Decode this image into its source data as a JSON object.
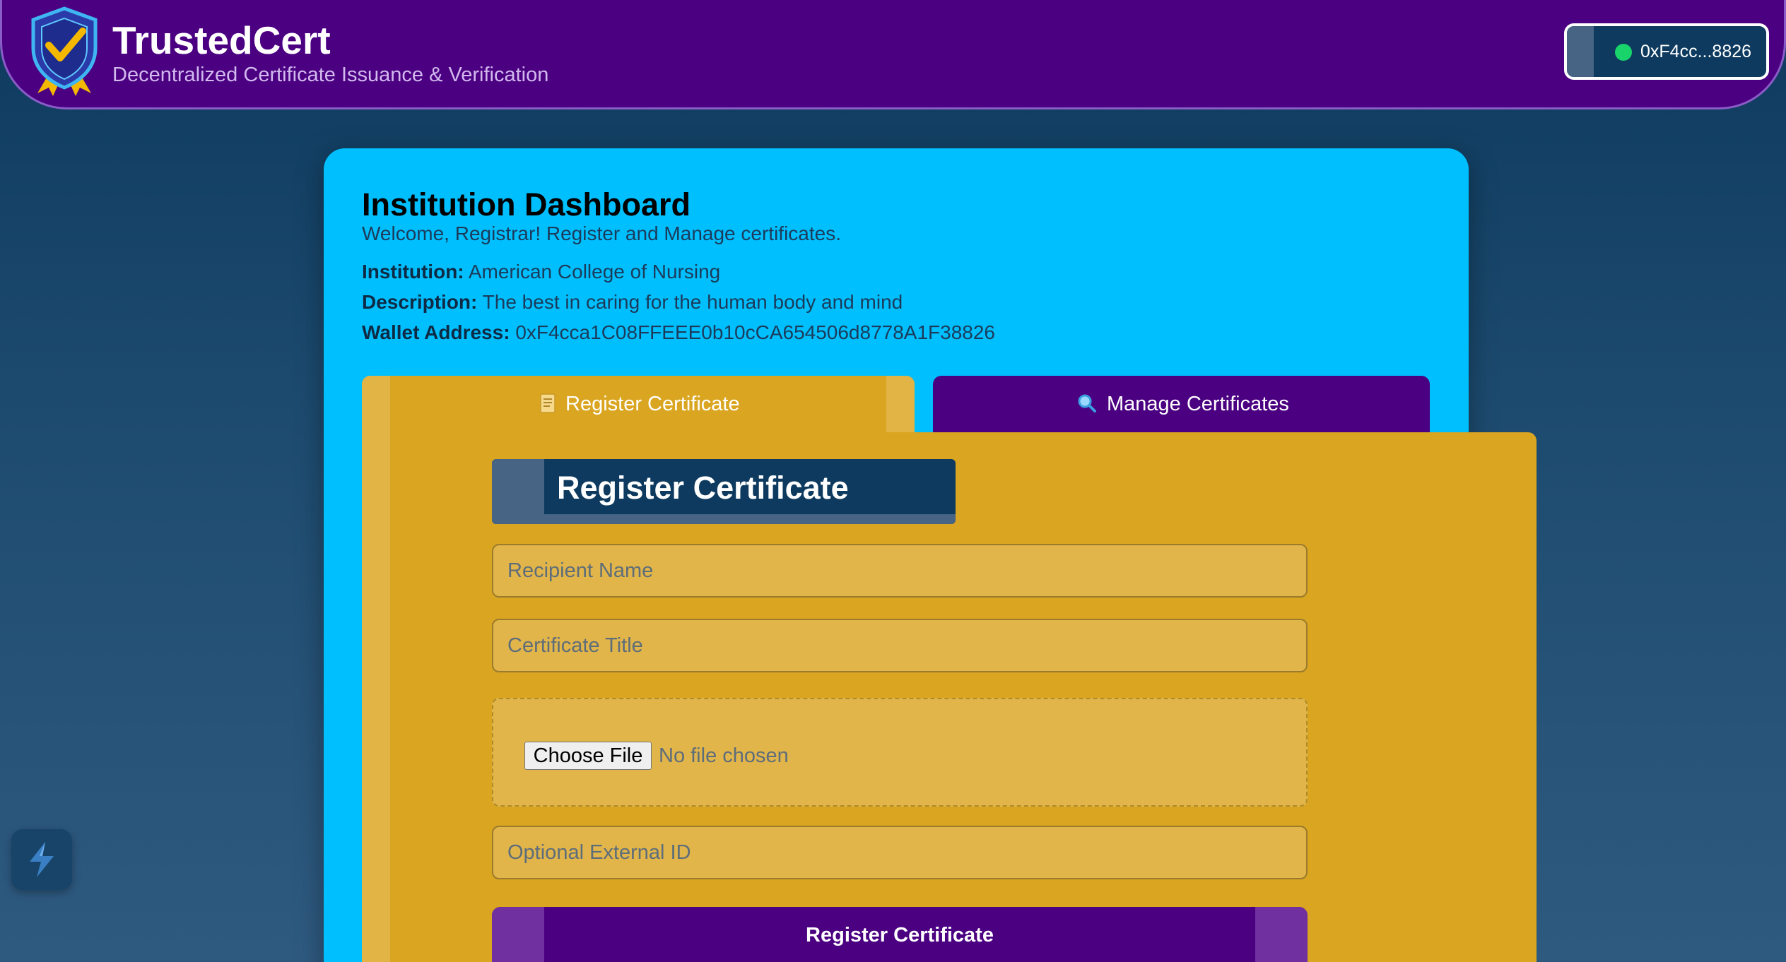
{
  "header": {
    "title": "TrustedCert",
    "subtitle": "Decentralized Certificate Issuance & Verification",
    "logo_icon": "shield-check-icon",
    "wallet": {
      "address_short": "0xF4cc...8826",
      "status_icon": "connected-dot-icon",
      "status_color": "#19d36b"
    }
  },
  "dashboard": {
    "title": "Institution Dashboard",
    "welcome": "Welcome, Registrar! Register and Manage certificates.",
    "institution_label": "Institution:",
    "institution_value": "American College of Nursing",
    "description_label": "Description:",
    "description_value": "The best in caring for the human body and mind",
    "wallet_label": "Wallet Address:",
    "wallet_value": "0xF4cca1C08FFEEE0b10cCA654506d8778A1F38826"
  },
  "tabs": [
    {
      "label": "Register Certificate",
      "icon": "document-icon",
      "active": true
    },
    {
      "label": "Manage Certificates",
      "icon": "magnifier-icon",
      "active": false
    }
  ],
  "form": {
    "heading": "Register Certificate",
    "recipient_placeholder": "Recipient Name",
    "title_placeholder": "Certificate Title",
    "file_button": "Choose File",
    "file_status": "No file chosen",
    "external_id_placeholder": "Optional External ID",
    "submit_label": "Register Certificate"
  },
  "colors": {
    "header_bg": "#4b0082",
    "card_bg": "#00bfff",
    "panel_bg": "#daa520",
    "accent_dark": "#0d3a5e"
  },
  "widget": {
    "icon": "lightning-icon"
  }
}
